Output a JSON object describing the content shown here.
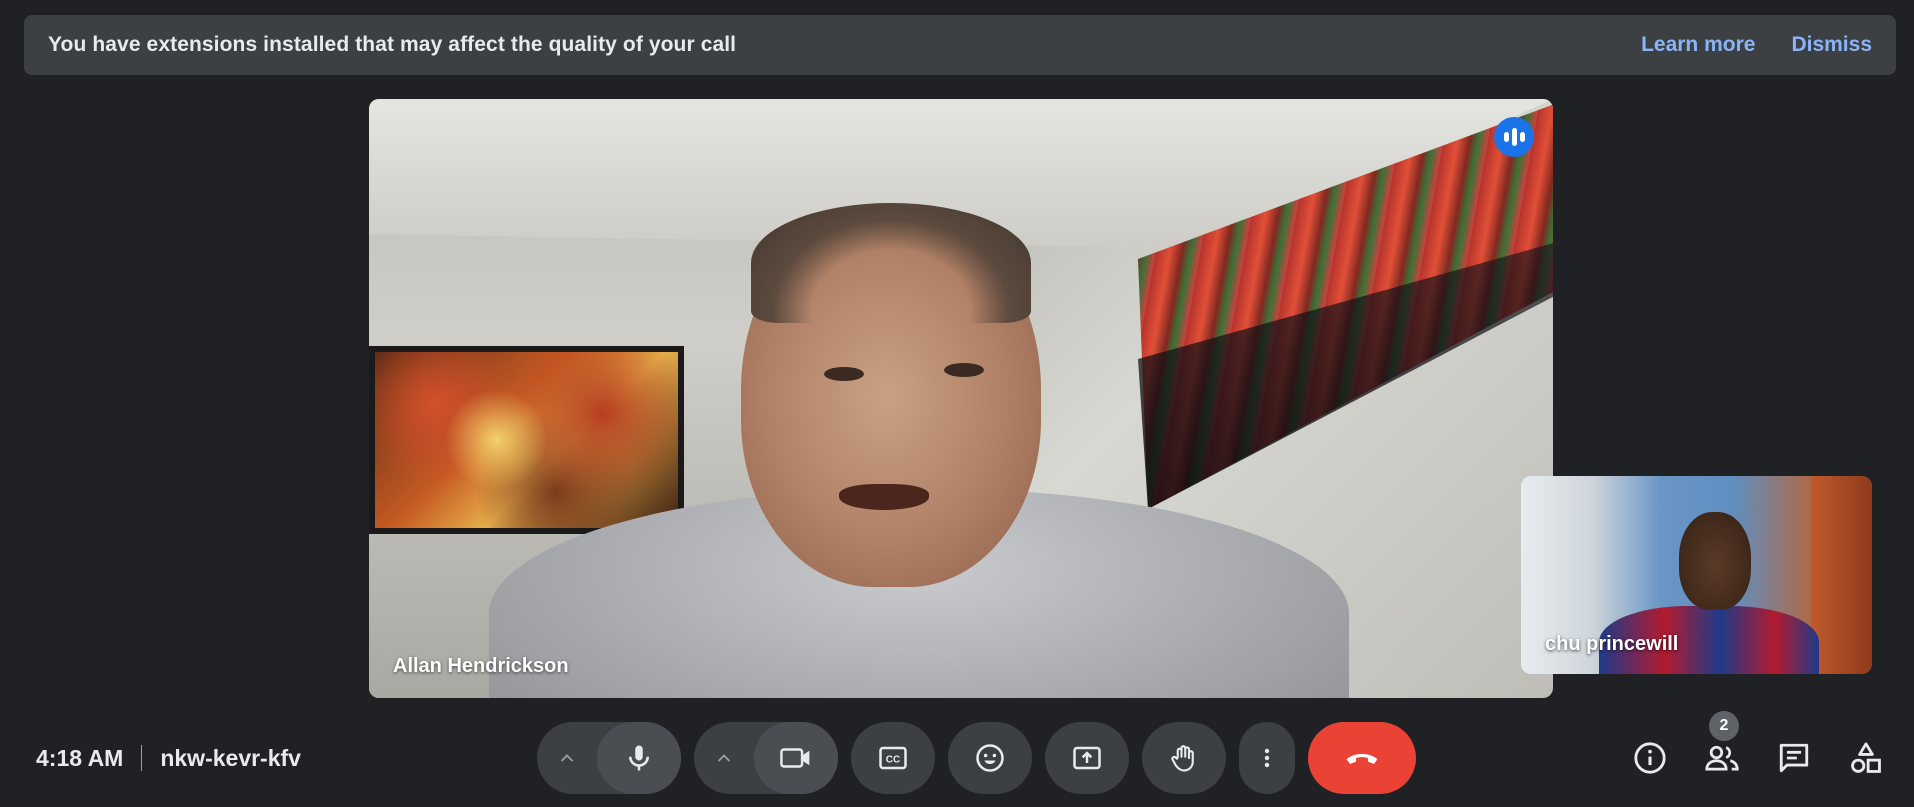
{
  "banner": {
    "message": "You have extensions installed that may affect the quality of your call",
    "learn_more": "Learn more",
    "dismiss": "Dismiss"
  },
  "main_participant": {
    "name": "Allan Hendrickson",
    "speaking": true
  },
  "self_participant": {
    "name": "chu princewill"
  },
  "meeting": {
    "time": "4:18 AM",
    "code": "nkw-kevr-kfv"
  },
  "controls": [
    {
      "name": "audio-options",
      "icon": "chevron-up-icon"
    },
    {
      "name": "microphone",
      "icon": "microphone-icon"
    },
    {
      "name": "video-options",
      "icon": "chevron-up-icon"
    },
    {
      "name": "camera",
      "icon": "video-camera-icon"
    },
    {
      "name": "captions",
      "icon": "closed-captions-icon"
    },
    {
      "name": "reactions",
      "icon": "smiley-icon"
    },
    {
      "name": "present",
      "icon": "present-screen-icon"
    },
    {
      "name": "raise-hand",
      "icon": "hand-icon"
    },
    {
      "name": "more-options",
      "icon": "more-vertical-icon"
    },
    {
      "name": "leave-call",
      "icon": "phone-hangup-icon"
    }
  ],
  "side_controls": {
    "participants_count": "2",
    "items": [
      {
        "name": "meeting-details",
        "icon": "info-icon"
      },
      {
        "name": "people",
        "icon": "people-icon"
      },
      {
        "name": "chat",
        "icon": "chat-icon"
      },
      {
        "name": "activities",
        "icon": "activities-icon"
      }
    ]
  },
  "colors": {
    "background": "#202124",
    "surface": "#3c4043",
    "link": "#8ab4f8",
    "end_call": "#ea4335",
    "speaking_indicator": "#1a73e8"
  }
}
